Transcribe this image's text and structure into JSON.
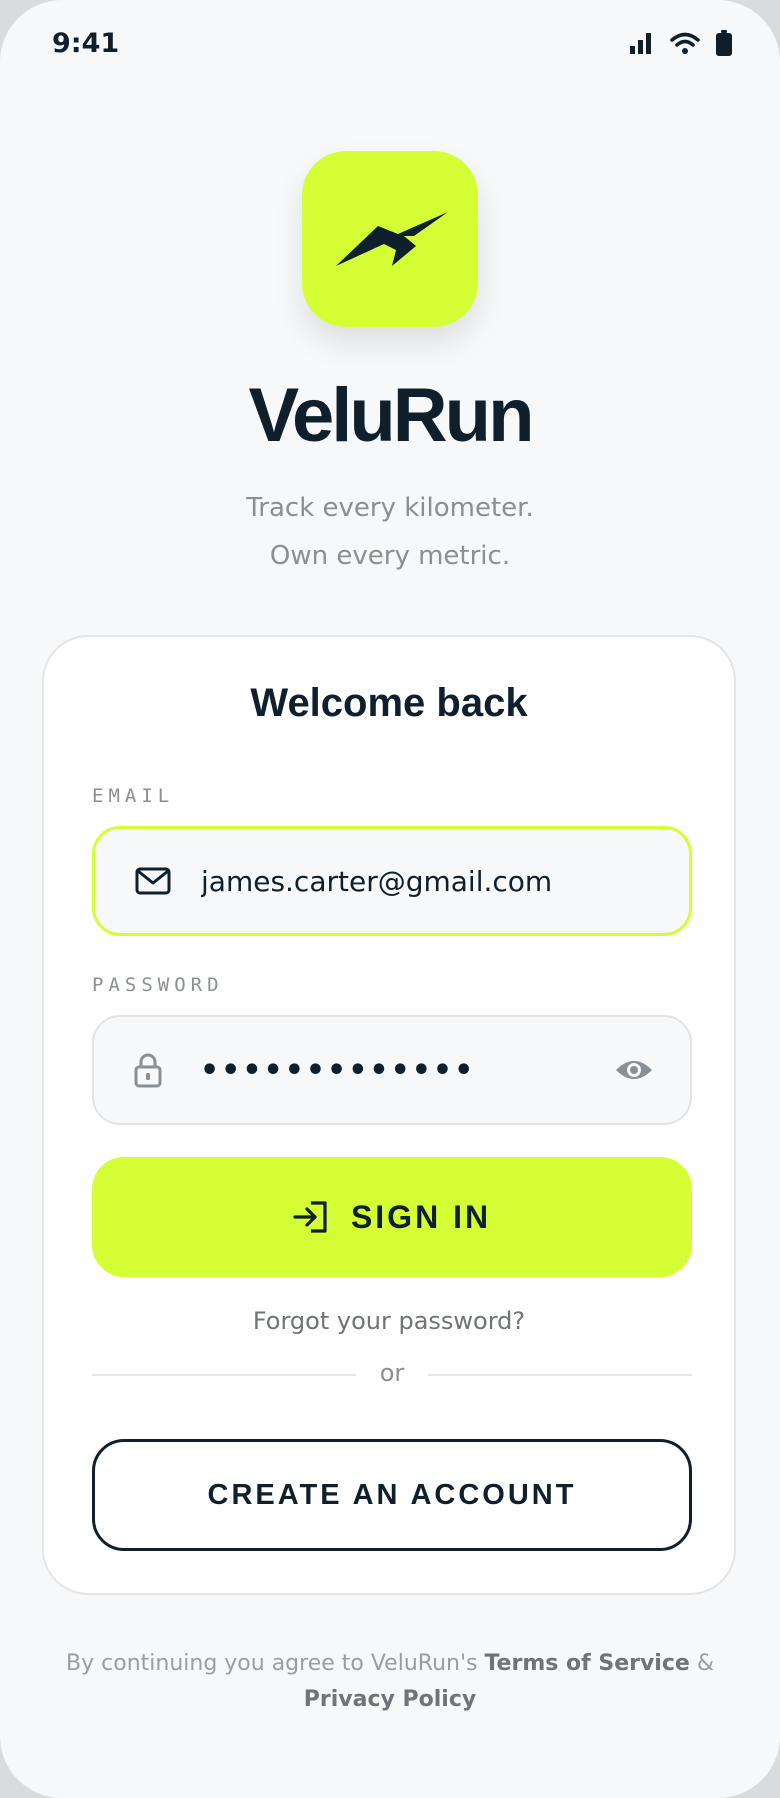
{
  "status_bar": {
    "time": "9:41"
  },
  "brand": {
    "name": "VeluRun",
    "tagline_line1": "Track every kilometer.",
    "tagline_line2": "Own every metric.",
    "accent_color": "#d4ff34",
    "dark_color": "#0f1f2b"
  },
  "login_card": {
    "heading": "Welcome back",
    "email": {
      "label": "EMAIL",
      "value": "james.carter@gmail.com",
      "icon": "mail-icon"
    },
    "password": {
      "label": "PASSWORD",
      "masked_value": "•••••••••••••",
      "icon": "lock-icon",
      "toggle_icon": "eye-icon"
    },
    "sign_in_label": "SIGN IN",
    "sign_in_icon": "login-arrow-icon",
    "forgot_label": "Forgot your password?",
    "divider_text": "or",
    "create_account_label": "CREATE AN ACCOUNT"
  },
  "legal": {
    "prefix": "By continuing you agree to VeluRun's",
    "terms_label": "Terms of Service",
    "amp": "&",
    "privacy_label": "Privacy Policy"
  }
}
